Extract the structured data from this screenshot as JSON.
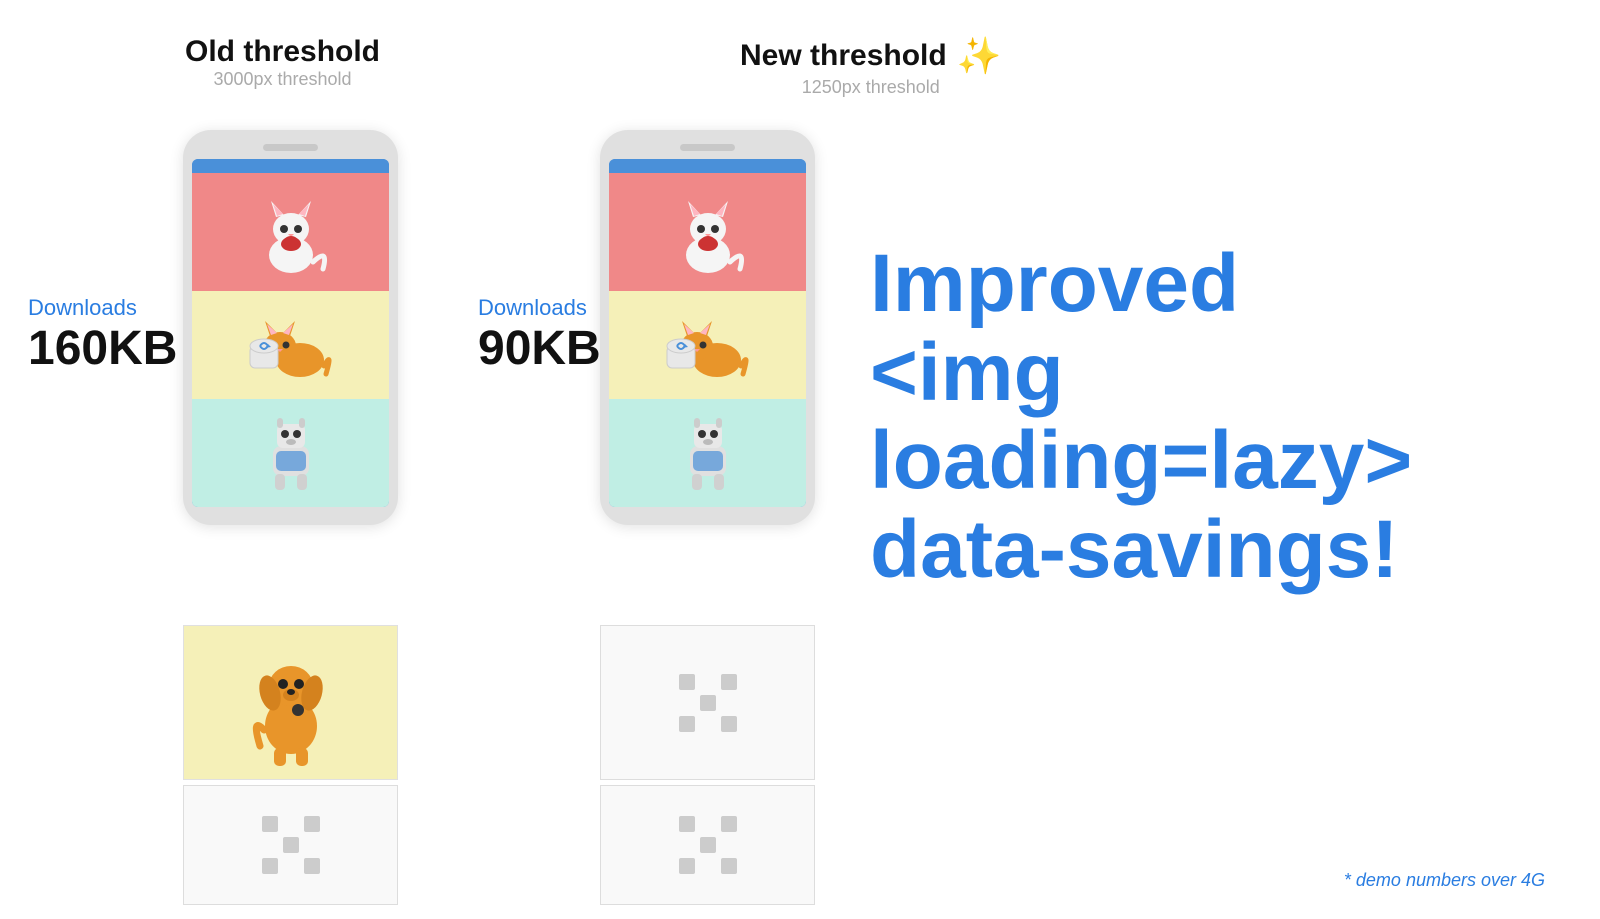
{
  "leftThreshold": {
    "title": "Old threshold",
    "subtitle": "3000px threshold"
  },
  "rightThreshold": {
    "title": "New threshold",
    "subtitle": "1250px threshold"
  },
  "leftDownloads": {
    "label": "Downloads",
    "size": "160KB"
  },
  "rightDownloads": {
    "label": "Downloads",
    "size": "90KB"
  },
  "message": {
    "line1": "Improved",
    "line2": "<img loading=lazy>",
    "line3": "data-savings!"
  },
  "demoNote": "* demo numbers over 4G",
  "colors": {
    "blue": "#2a7de1",
    "darkText": "#111111",
    "grayText": "#999999",
    "gold": "#f5c518"
  }
}
